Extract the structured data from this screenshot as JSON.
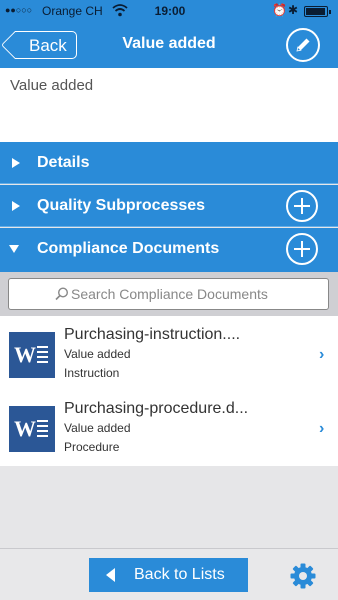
{
  "status_bar": {
    "signal": "●●○○○",
    "carrier": "Orange CH",
    "time": "19:00"
  },
  "nav": {
    "back_label": "Back",
    "title": "Value added"
  },
  "item_title": "Value added",
  "sections": [
    {
      "label": "Details",
      "expanded": false,
      "has_add": false
    },
    {
      "label": "Quality Subprocesses",
      "expanded": false,
      "has_add": true
    },
    {
      "label": "Compliance Documents",
      "expanded": true,
      "has_add": true
    }
  ],
  "search": {
    "placeholder": "Search Compliance Documents",
    "value": ""
  },
  "documents": [
    {
      "icon": "word-document-icon",
      "name": "Purchasing-instruction....",
      "line1": "Value added",
      "line2": "Instruction"
    },
    {
      "icon": "word-document-icon",
      "name": "Purchasing-procedure.d...",
      "line1": "Value added",
      "line2": "Procedure"
    }
  ],
  "bottom": {
    "back_to_lists_label": "Back to Lists"
  },
  "colors": {
    "accent": "#2a8bd8",
    "word_blue": "#2b5796",
    "background": "#e6e6e8"
  }
}
